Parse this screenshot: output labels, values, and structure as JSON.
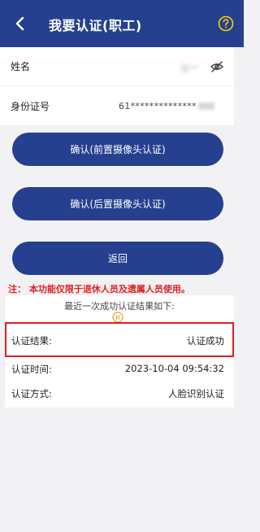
{
  "header": {
    "title": "我要认证(职工)",
    "background_color": "#26408f",
    "back_icon": "chevron-left-icon",
    "help_icon": "question-circle-icon"
  },
  "form": {
    "name_label": "姓名",
    "name_value_masked": "张**",
    "id_label": "身份证号",
    "id_value_masked": "61**************"
  },
  "buttons": {
    "front_camera": "确认(前置摄像头认证)",
    "back_camera": "确认(后置摄像头认证)",
    "return": "返回"
  },
  "notice": "注：  本功能仅限于退休人员及遗属人员使用。",
  "result": {
    "title": "最近一次成功认证结果如下:",
    "rows": [
      {
        "label": "认证结果:",
        "value": "认证成功"
      },
      {
        "label": "认证时间:",
        "value": "2023-10-04 09:54:32"
      },
      {
        "label": "认证方式:",
        "value": "人脸识别认证"
      }
    ],
    "highlight_color": "#e01f1f"
  }
}
